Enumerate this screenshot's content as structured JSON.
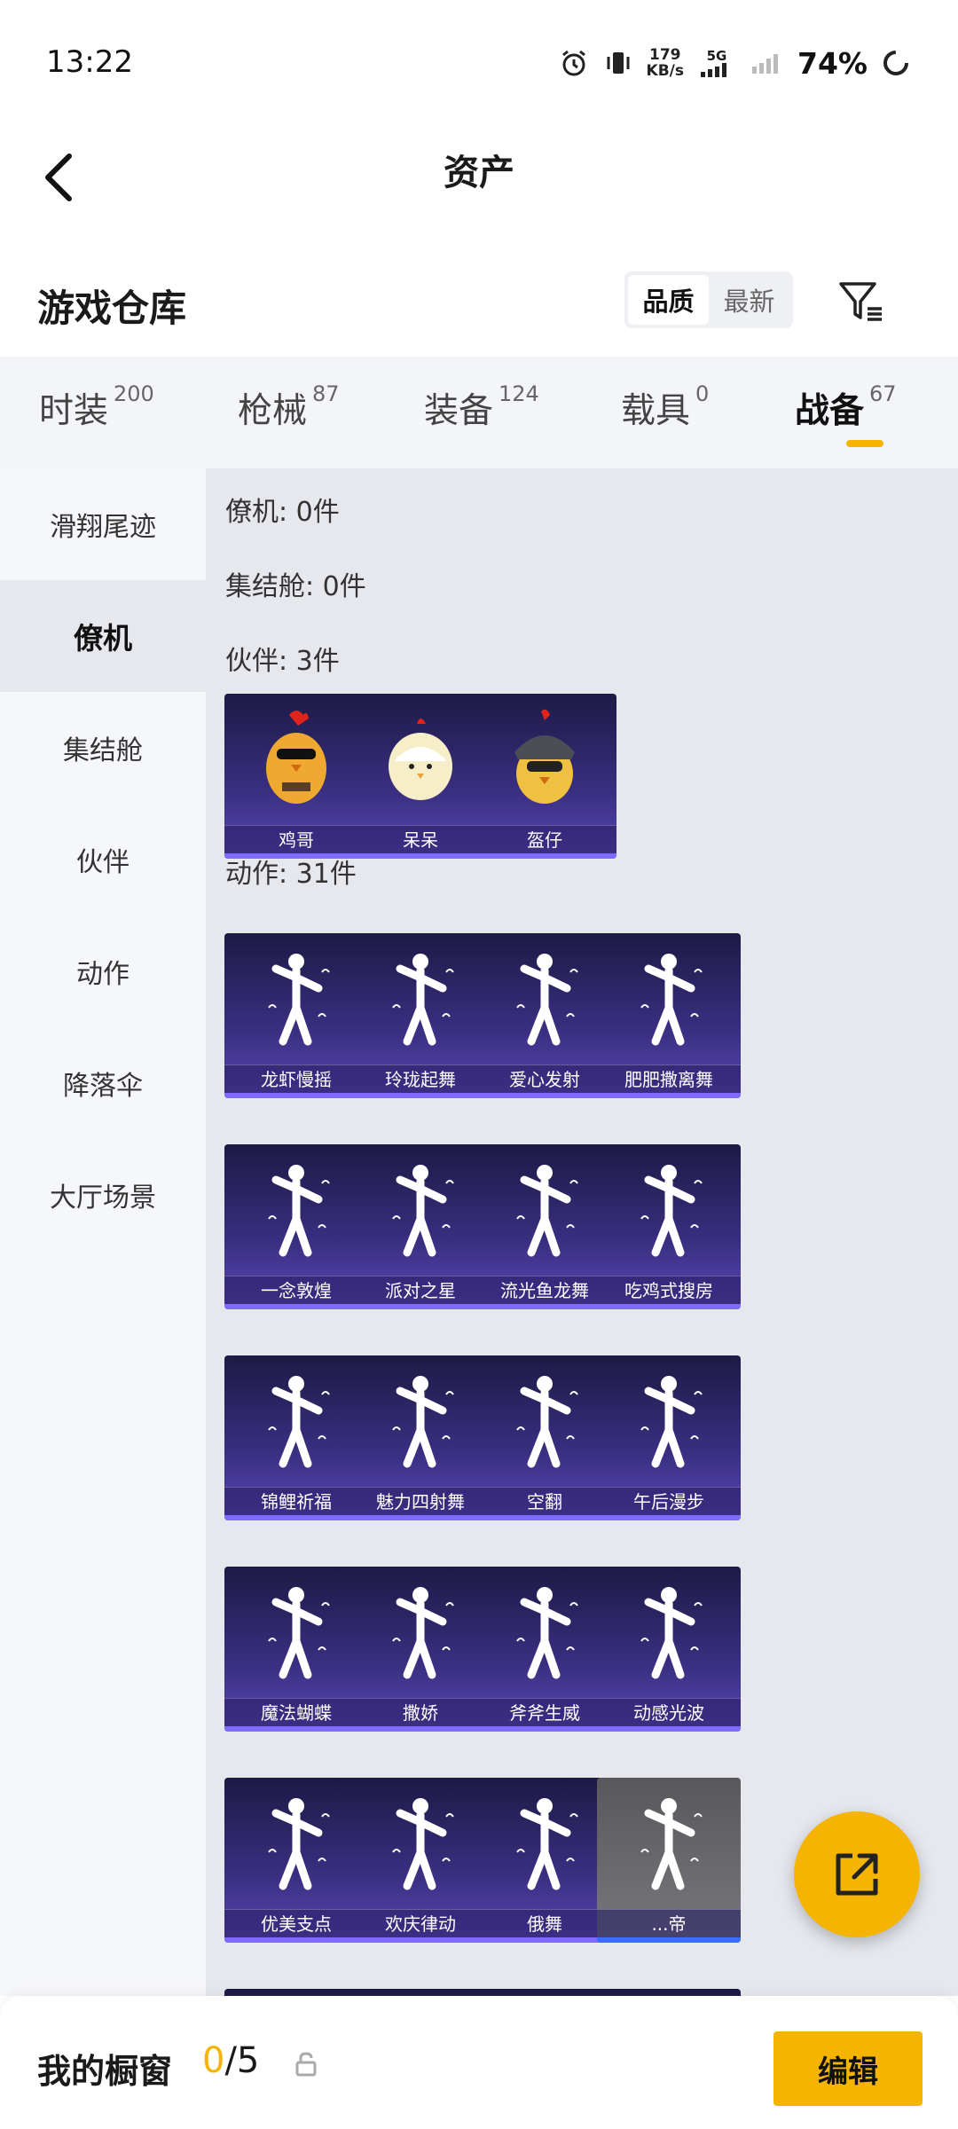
{
  "status_bar": {
    "time": "13:22",
    "net_speed_value": "179",
    "net_speed_unit": "KB/s",
    "network_type": "5G",
    "battery": "74%",
    "icons": [
      "alarm-icon",
      "vibrate-icon",
      "signal-icon",
      "battery-ring-icon"
    ]
  },
  "header": {
    "title": "资产",
    "back_icon": "chevron-left-icon"
  },
  "section": {
    "title": "游戏仓库",
    "sort_options": [
      "品质",
      "最新"
    ],
    "selected_sort": "品质",
    "filter_icon": "filter-funnel-icon"
  },
  "tabs": [
    {
      "label": "时装",
      "count": "200"
    },
    {
      "label": "枪械",
      "count": "87"
    },
    {
      "label": "装备",
      "count": "124"
    },
    {
      "label": "载具",
      "count": "0"
    },
    {
      "label": "战备",
      "count": "67",
      "active": true
    }
  ],
  "sidebar": {
    "items": [
      {
        "label": "滑翔尾迹"
      },
      {
        "label": "僚机",
        "active": true
      },
      {
        "label": "集结舱"
      },
      {
        "label": "伙伴"
      },
      {
        "label": "动作"
      },
      {
        "label": "降落伞"
      },
      {
        "label": "大厅场景"
      }
    ]
  },
  "content": {
    "groups": {
      "wingman": "僚机: 0件",
      "pod": "集结舱: 0件",
      "partner": "伙伴: 3件",
      "action": "动作: 31件"
    },
    "partners": [
      "鸡哥",
      "呆呆",
      "盔仔"
    ],
    "actions": [
      "龙虾慢摇",
      "玲珑起舞",
      "爱心发射",
      "肥肥撒离舞",
      "一念敦煌",
      "派对之星",
      "流光鱼龙舞",
      "吃鸡式搜房",
      "锦鲤祈福",
      "魅力四射舞",
      "空翻",
      "午后漫步",
      "魔法蝴蝶",
      "撒娇",
      "斧斧生威",
      "动感光波",
      "优美支点",
      "欢庆律动",
      "俄舞",
      "...帝"
    ]
  },
  "fab": {
    "icon": "share-external-icon"
  },
  "bottom_bar": {
    "title": "我的橱窗",
    "current": "0",
    "total": "/5",
    "lock_icon": "lock-icon",
    "edit_label": "编辑"
  },
  "colors": {
    "accent": "#f5b400",
    "card_top": "#1d1a45",
    "card_bottom": "#5a48b6",
    "content_bg": "#e6e8ee"
  }
}
